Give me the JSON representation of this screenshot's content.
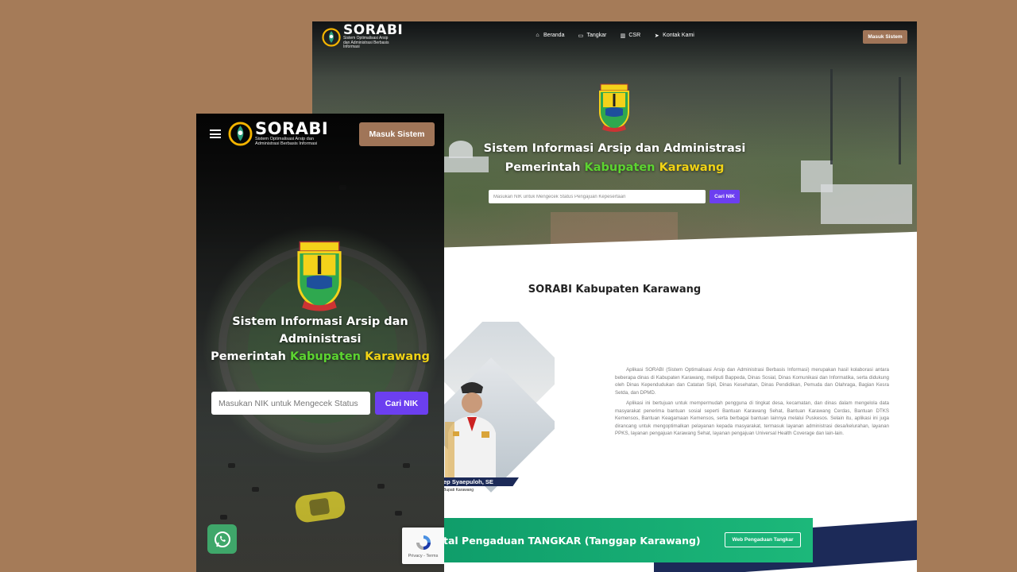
{
  "desktop": {
    "brand": {
      "name": "SORABI",
      "tagline": "Sistem Optimalisasi Arsip dan Administrasi Berbasis Informasi"
    },
    "nav": [
      {
        "label": "Beranda",
        "icon": "home-icon"
      },
      {
        "label": "Tangkar",
        "icon": "inbox-icon"
      },
      {
        "label": "CSR",
        "icon": "chart-icon"
      },
      {
        "label": "Kontak Kami",
        "icon": "send-icon"
      }
    ],
    "login_label": "Masuk Sistem",
    "hero": {
      "title_line1": "Sistem Informasi Arsip dan Administrasi",
      "title_pre": "Pemerintah ",
      "title_green": "Kabupaten ",
      "title_yellow": "Karawang",
      "search_placeholder": "Masukan NIK untuk Mengecek Status Pengajuan Kepesertaan",
      "search_button": "Cari NIK"
    },
    "section_title": "SORABI Kabupaten Karawang",
    "official": {
      "name": "ep Syaepuloh, SE",
      "role": "Bupati Karawang"
    },
    "paragraphs": [
      "Aplikasi SORABI (Sistem Optimalisasi Arsip dan Administrasi Berbasis Informasi) merupakan hasil kolaborasi antara beberapa dinas di Kabupaten Karawang, meliputi Bappeda, Dinas Sosial, Dinas Komunikasi dan Informatika, serta didukung oleh Dinas Kependudukan dan Catatan Sipil, Dinas Kesehatan, Dinas Pendidikan, Pemuda dan Olahraga, Bagian Kesra Setda, dan DPMD.",
      "Aplikasi ini bertujuan untuk mempermudah pengguna di tingkat desa, kecamatan, dan dinas dalam mengelola data masyarakat penerima bantuan sosial seperti Bantuan Karawang Sehat, Bantuan Karawang Cerdas, Bantuan DTKS Kemensos, Bantuan Keagamaan Kemensos, serta berbagai bantuan lainnya melalui Puskesos. Selain itu, aplikasi ini juga dirancang untuk mengoptimalkan pelayanan kepada masyarakat, termasuk layanan administrasi desa/kelurahan, layanan PPKS, layanan pengajuan Karawang Sehat, layanan pengajuan Universal Health Coverage dan lain-lain."
    ],
    "banner": {
      "text": "tal Pengaduan TANGKAR (Tanggap Karawang)",
      "button": "Web Pengaduan Tangkar"
    }
  },
  "mobile": {
    "brand": {
      "name": "SORABI",
      "tagline": "Sistem Optimalisasi Arsip dan Administrasi Berbasis Informasi"
    },
    "login_label": "Masuk Sistem",
    "hero": {
      "title_line1": "Sistem Informasi Arsip dan",
      "title_line2": "Administrasi",
      "title_pre": "Pemerintah ",
      "title_green": "Kabupaten ",
      "title_yellow": "Karawang",
      "search_placeholder": "Masukan NIK untuk Mengecek Status",
      "search_button": "Cari NIK"
    },
    "recaptcha_text": "Privacy - Terms"
  },
  "colors": {
    "background": "#a57b58",
    "login_button": "#a07558",
    "search_button": "#6c3ff0",
    "highlight_green": "#5cd430",
    "highlight_yellow": "#f1d315",
    "banner_green": "#1cb87a",
    "navy": "#1c2a58"
  }
}
